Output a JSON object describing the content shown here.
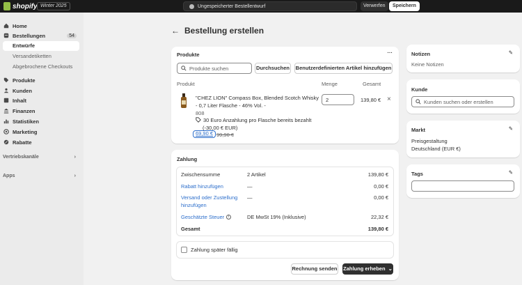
{
  "topbar": {
    "brand": "shopify",
    "edition": "Winter 2025",
    "unsaved_text": "Ungespeicherter Bestellentwurf",
    "discard_label": "Verwerfen",
    "save_label": "Speichern"
  },
  "sidebar": {
    "items": [
      {
        "label": "Home",
        "icon": "home-icon"
      },
      {
        "label": "Bestellungen",
        "icon": "orders-icon",
        "badge": "54"
      },
      {
        "label": "Entwürfe",
        "sub": true,
        "active": true
      },
      {
        "label": "Versandetiketten",
        "sub": true
      },
      {
        "label": "Abgebrochene Checkouts",
        "sub": true
      },
      {
        "label": "Produkte",
        "icon": "tag-icon"
      },
      {
        "label": "Kunden",
        "icon": "person-icon"
      },
      {
        "label": "Inhalt",
        "icon": "content-icon"
      },
      {
        "label": "Finanzen",
        "icon": "bank-icon"
      },
      {
        "label": "Statistiken",
        "icon": "chart-icon"
      },
      {
        "label": "Marketing",
        "icon": "target-icon"
      },
      {
        "label": "Rabatte",
        "icon": "discount-icon"
      }
    ],
    "sales_channels": "Vertriebskanäle",
    "apps": "Apps"
  },
  "page": {
    "title": "Bestellung erstellen"
  },
  "products": {
    "title": "Produkte",
    "search_placeholder": "Produkte suchen",
    "browse_label": "Durchsuchen",
    "custom_label": "Benutzerdefinierten Artikel hinzufügen",
    "col_product": "Produkt",
    "col_qty": "Menge",
    "col_total": "Gesamt",
    "item": {
      "name_line1": "\"CHEZ LION\" Compass Box, Blended Scotch Whisky",
      "name_line2": "- 0,7 Liter Flasche - 46% Vol. -",
      "sku": "808",
      "discount_line1": "30 Euro Anzahlung pro Flasche bereits bezahlt",
      "discount_line2": "(-30,00 € EUR)",
      "price_new": "69,90 €",
      "price_old": "99,90 €",
      "quantity": "2",
      "total": "139,80 €"
    }
  },
  "payment": {
    "title": "Zahlung",
    "rows": [
      {
        "label": "Zwischensumme",
        "middle": "2 Artikel",
        "amount": "139,80 €"
      },
      {
        "label": "Rabatt hinzufügen",
        "middle": "—",
        "amount": "0,00 €"
      },
      {
        "label": "Versand oder Zustellung",
        "label2": "hinzufügen",
        "middle": "—",
        "amount": "0,00 €"
      },
      {
        "label": "Geschätzte Steuer",
        "middle": "DE MwSt 19% (Inklusive)",
        "amount": "22,32 €"
      },
      {
        "label": "Gesamt",
        "middle": "",
        "amount": "139,80 €"
      }
    ],
    "later_label": "Zahlung später fällig",
    "invoice_label": "Rechnung senden",
    "collect_label": "Zahlung erheben"
  },
  "notes": {
    "title": "Notizen",
    "empty": "Keine Notizen"
  },
  "customer": {
    "title": "Kunde",
    "placeholder": "Kunden suchen oder erstellen"
  },
  "market": {
    "title": "Markt",
    "pricing_label": "Preisgestaltung",
    "pricing_value": "Deutschland (EUR €)"
  },
  "tags": {
    "title": "Tags"
  },
  "colors": {
    "accent": "#2c6ecb",
    "topbar": "#1a1a1a",
    "brand_green": "#95bf47"
  }
}
